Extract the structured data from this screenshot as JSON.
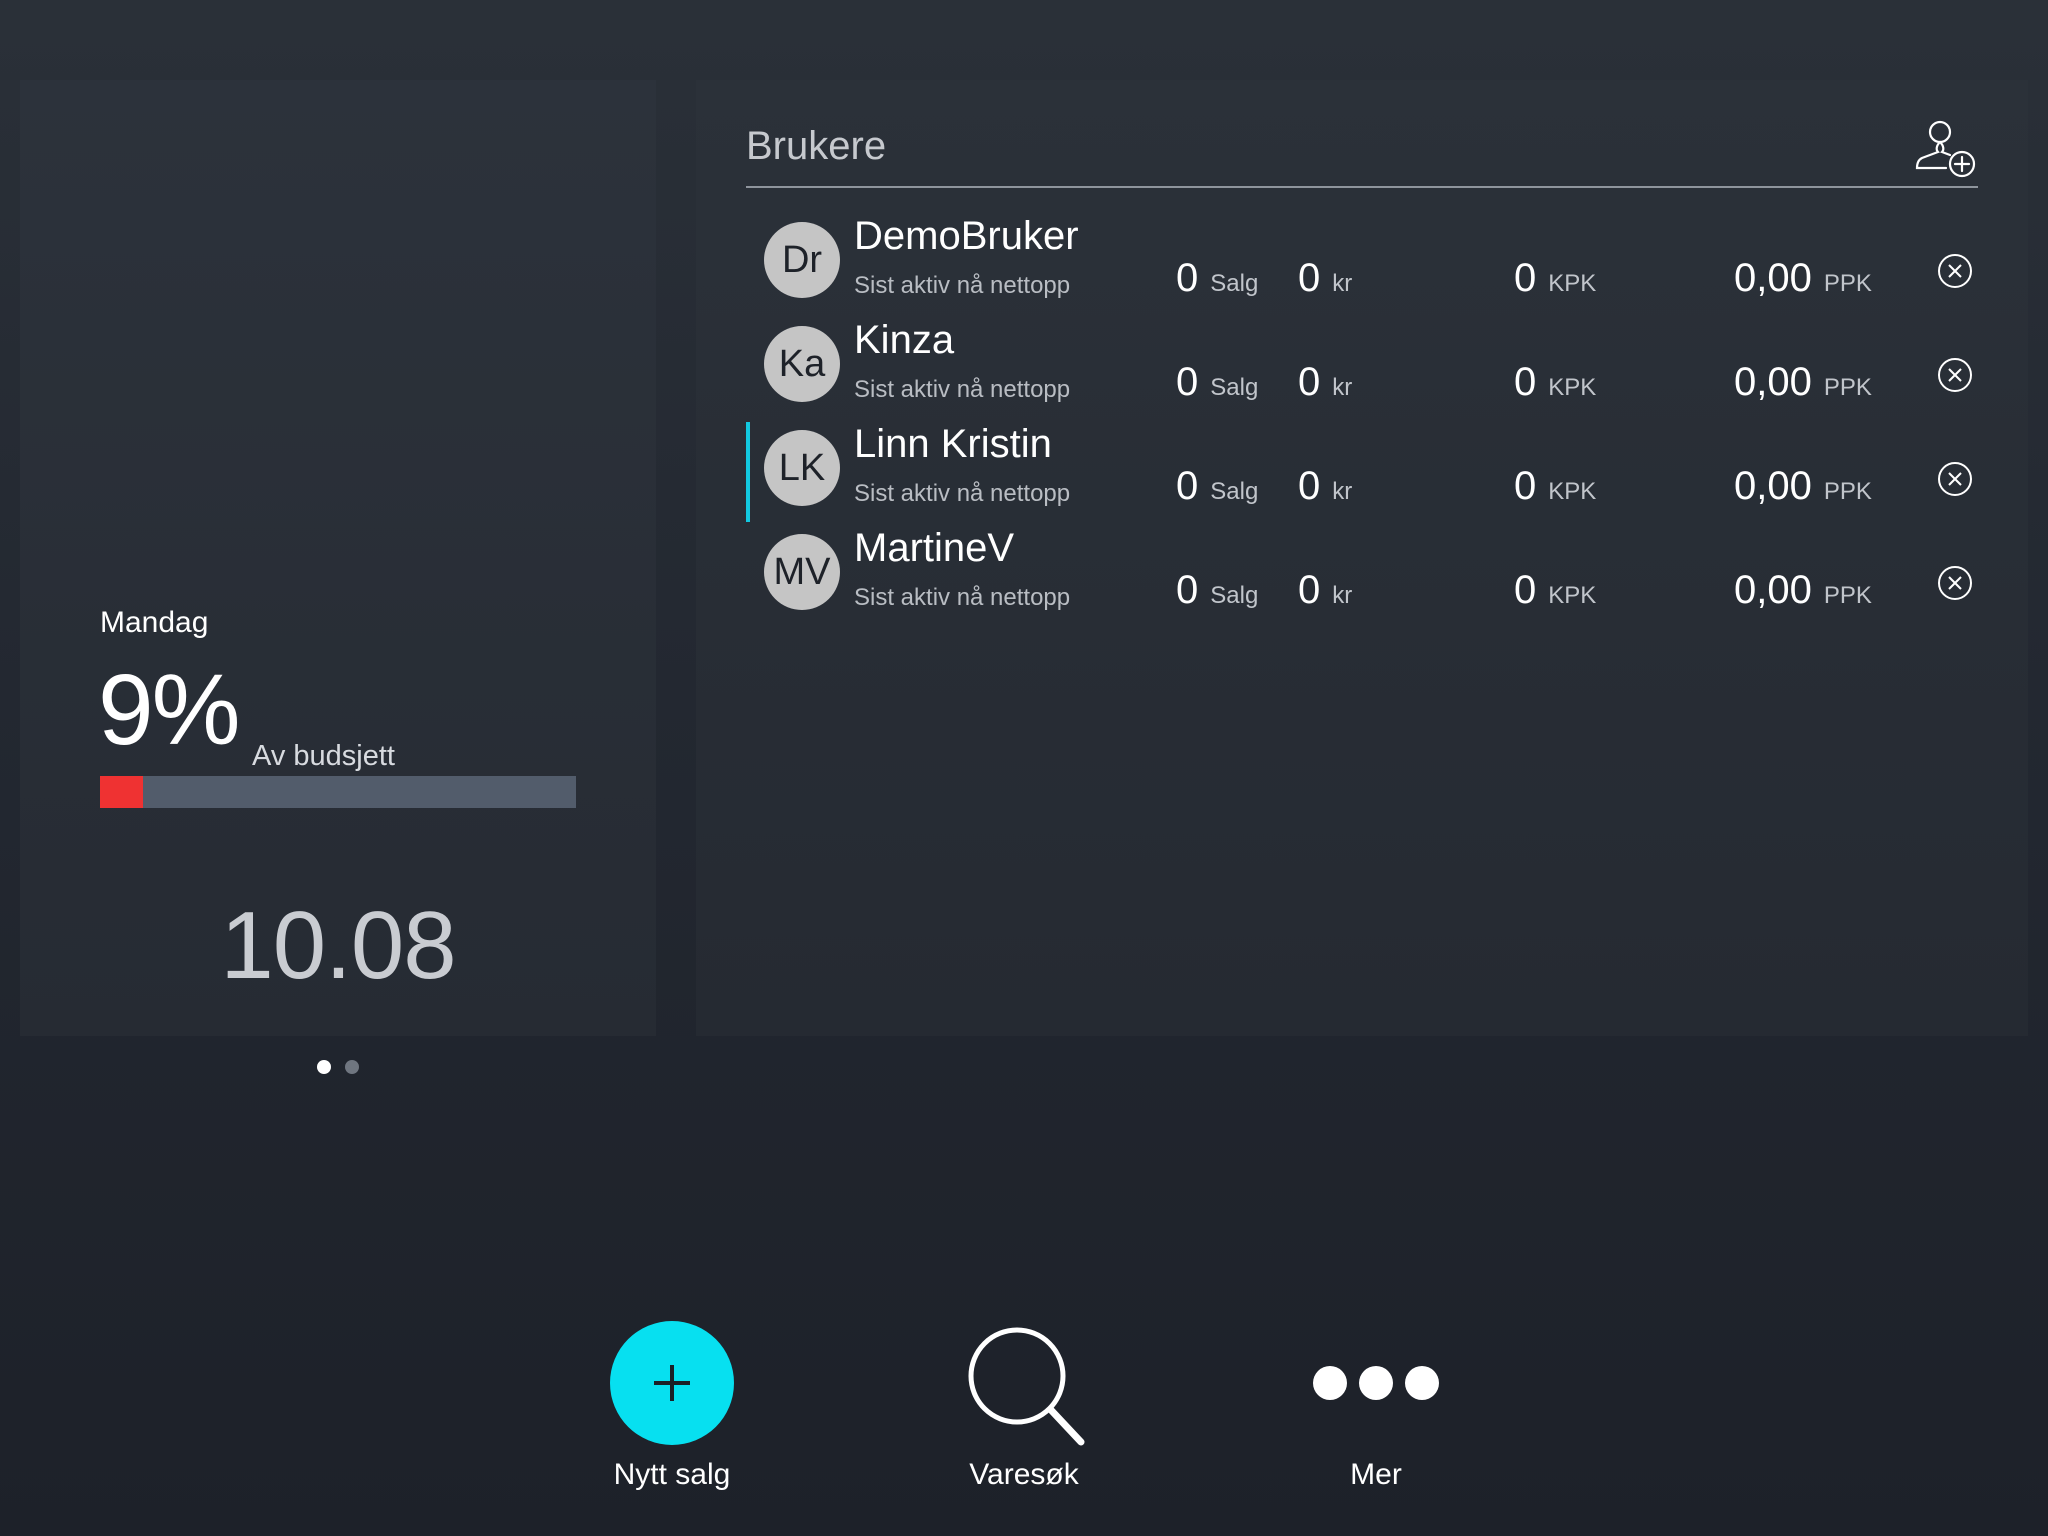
{
  "budget": {
    "day": "Mandag",
    "percent_label": "9%",
    "percent_value": 0.09,
    "subtitle": "Av budsjett",
    "date": "10.08",
    "pager_count": 2,
    "pager_active": 0,
    "colors": {
      "fill": "#ef3232",
      "track": "#525c6b"
    }
  },
  "users_panel": {
    "title": "Brukere",
    "add_user_icon": "add-user-icon"
  },
  "users": [
    {
      "initials": "Dr",
      "name": "DemoBruker",
      "status": "Sist aktiv nå nettopp",
      "salg": "0",
      "salg_unit": "Salg",
      "kr": "0",
      "kr_unit": "kr",
      "kpk": "0",
      "kpk_unit": "KPK",
      "ppk": "0,00",
      "ppk_unit": "PPK",
      "selected": false
    },
    {
      "initials": "Ka",
      "name": "Kinza",
      "status": "Sist aktiv nå nettopp",
      "salg": "0",
      "salg_unit": "Salg",
      "kr": "0",
      "kr_unit": "kr",
      "kpk": "0",
      "kpk_unit": "KPK",
      "ppk": "0,00",
      "ppk_unit": "PPK",
      "selected": false
    },
    {
      "initials": "LK",
      "name": "Linn Kristin",
      "status": "Sist aktiv nå nettopp",
      "salg": "0",
      "salg_unit": "Salg",
      "kr": "0",
      "kr_unit": "kr",
      "kpk": "0",
      "kpk_unit": "KPK",
      "ppk": "0,00",
      "ppk_unit": "PPK",
      "selected": true
    },
    {
      "initials": "MV",
      "name": "MartineV",
      "status": "Sist aktiv nå nettopp",
      "salg": "0",
      "salg_unit": "Salg",
      "kr": "0",
      "kr_unit": "kr",
      "kpk": "0",
      "kpk_unit": "KPK",
      "ppk": "0,00",
      "ppk_unit": "PPK",
      "selected": false
    }
  ],
  "toolbar": {
    "new_sale_label": "Nytt salg",
    "search_label": "Varesøk",
    "more_label": "Mer",
    "accent_color": "#07e0f0"
  }
}
